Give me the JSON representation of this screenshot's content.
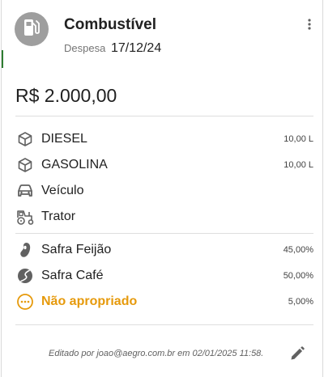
{
  "header": {
    "title": "Combustível",
    "type_label": "Despesa",
    "date": "17/12/24",
    "category_icon": "fuel-pump-icon"
  },
  "amount": "R$ 2.000,00",
  "items": [
    {
      "icon": "package-icon",
      "label": "DIESEL",
      "value": "10,00 L"
    },
    {
      "icon": "package-icon",
      "label": "GASOLINA",
      "value": "10,00 L"
    }
  ],
  "assets": [
    {
      "icon": "car-icon",
      "label": "Veículo"
    },
    {
      "icon": "tractor-icon",
      "label": "Trator"
    }
  ],
  "allocations": [
    {
      "icon": "bean-icon",
      "label": "Safra Feijão",
      "value": "45,00%"
    },
    {
      "icon": "coffee-bean-icon",
      "label": "Safra Café",
      "value": "50,00%"
    },
    {
      "icon": "more-circle-icon",
      "label": "Não apropriado",
      "value": "5,00%"
    }
  ],
  "footer": {
    "edited_text": "Editado por joao@aegro.com.br em 02/01/2025 11:58."
  },
  "colors": {
    "accent_green": "#2e7d32",
    "warning": "#e69a0c",
    "avatar_bg": "#9e9e9e"
  }
}
